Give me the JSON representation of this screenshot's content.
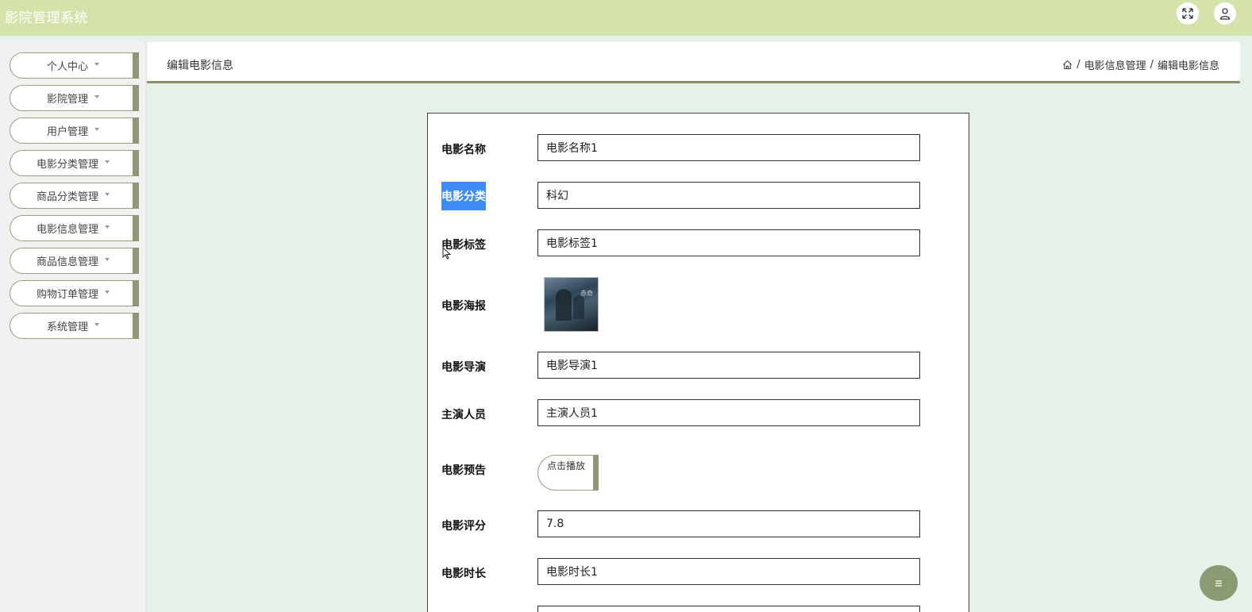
{
  "app": {
    "title": "影院管理系统"
  },
  "header_icons": {
    "fullscreen": "fullscreen-icon",
    "user": "user-icon"
  },
  "sidebar": {
    "items": [
      {
        "label": "个人中心"
      },
      {
        "label": "影院管理"
      },
      {
        "label": "用户管理"
      },
      {
        "label": "电影分类管理"
      },
      {
        "label": "商品分类管理"
      },
      {
        "label": "电影信息管理"
      },
      {
        "label": "商品信息管理"
      },
      {
        "label": "购物订单管理"
      },
      {
        "label": "系统管理"
      }
    ]
  },
  "page": {
    "title": "编辑电影信息",
    "breadcrumb": {
      "sep": "/",
      "parent": "电影信息管理",
      "current": "编辑电影信息"
    }
  },
  "form": {
    "name": {
      "label": "电影名称",
      "value": "电影名称1"
    },
    "category": {
      "label": "电影分类",
      "value": "科幻"
    },
    "tags": {
      "label": "电影标签",
      "value": "电影标签1"
    },
    "poster": {
      "label": "电影海报",
      "text": "赤奇"
    },
    "director": {
      "label": "电影导演",
      "value": "电影导演1"
    },
    "cast": {
      "label": "主演人员",
      "value": "主演人员1"
    },
    "trailer": {
      "label": "电影预告",
      "button": "点击播放"
    },
    "rating": {
      "label": "电影评分",
      "value": "7.8"
    },
    "duration": {
      "label": "电影时长",
      "value": "电影时长1"
    }
  },
  "colors": {
    "header": "#d3e3aa",
    "accent": "#8f9775",
    "background": "#e6f1ea",
    "selection": "#3d8bf5"
  }
}
